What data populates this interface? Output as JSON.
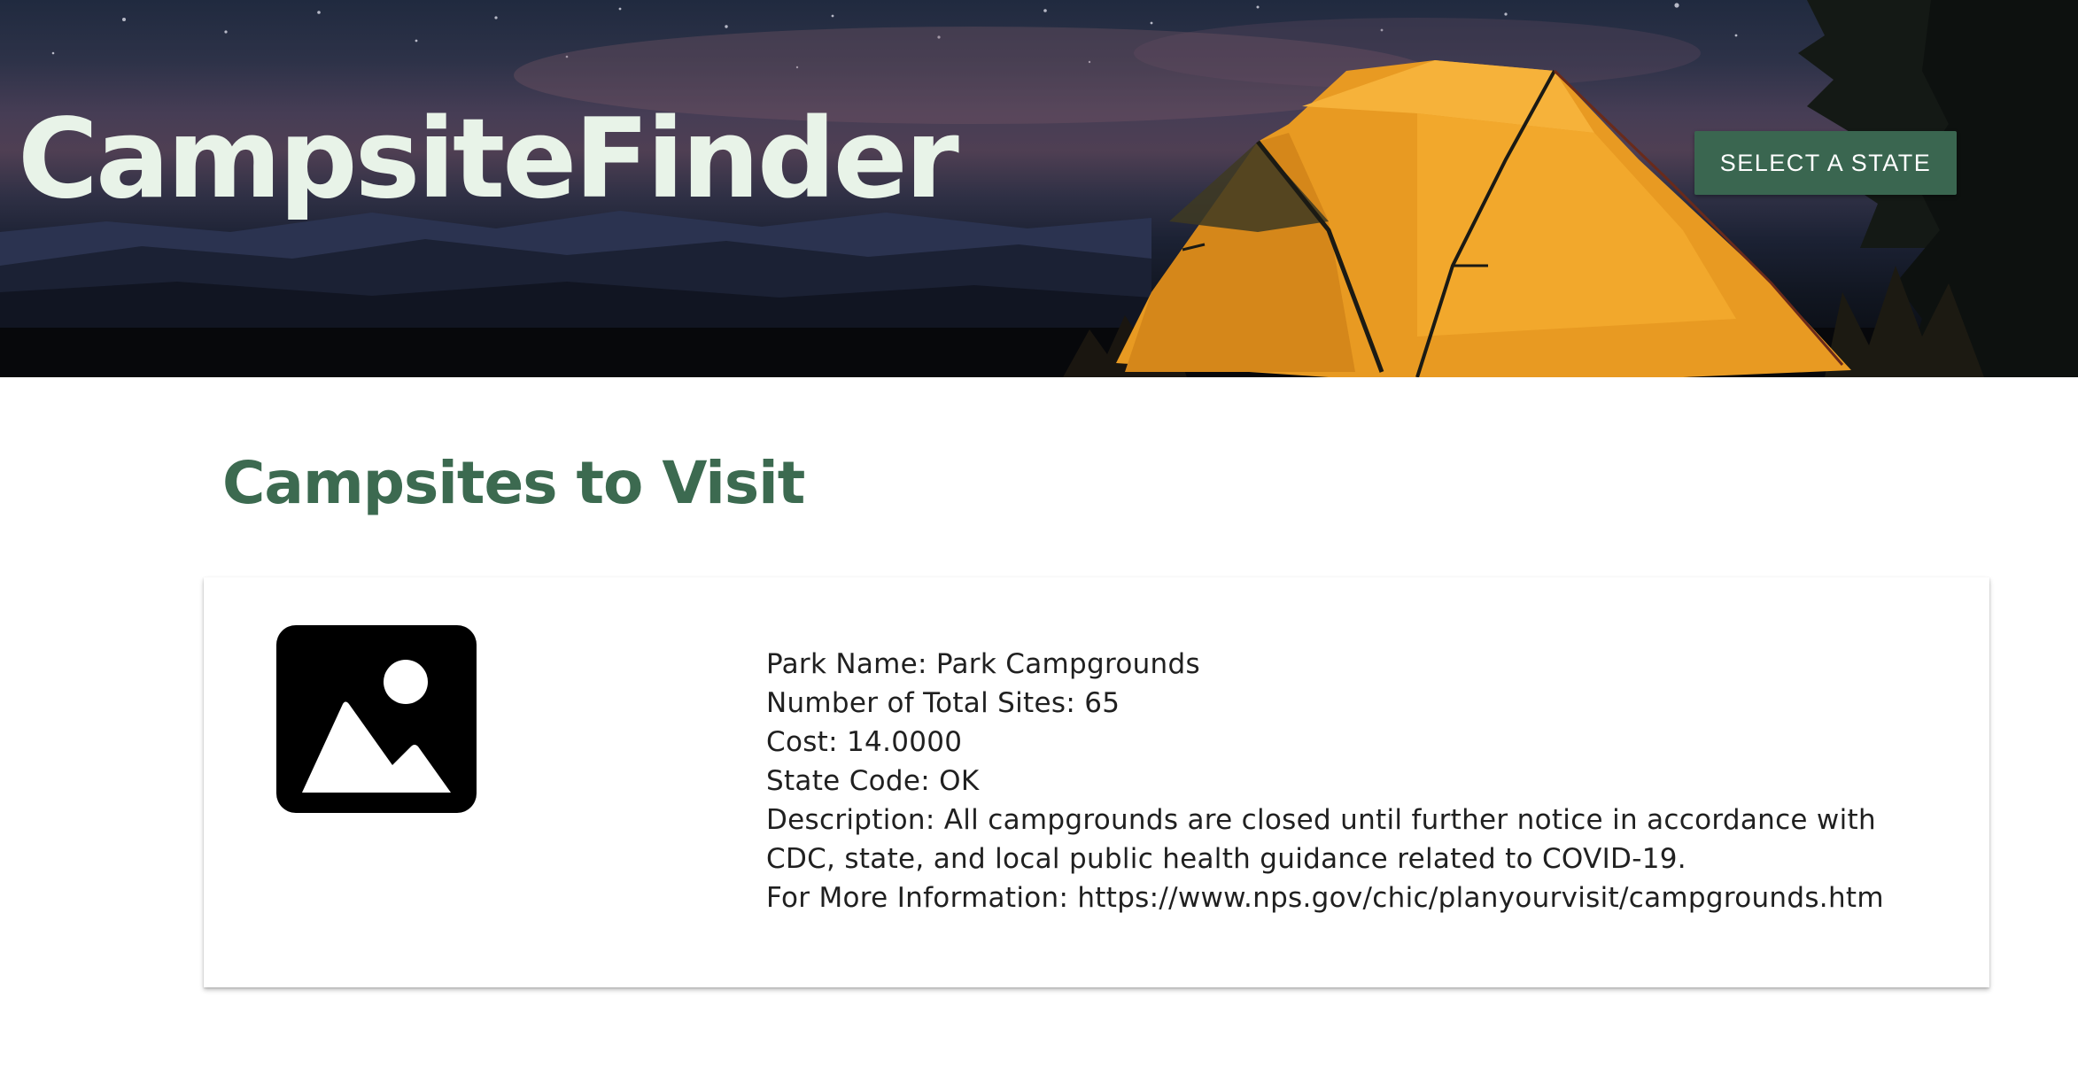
{
  "header": {
    "brand": "CampsiteFinder",
    "select_state_label": "SELECT A STATE"
  },
  "main": {
    "title": "Campsites to Visit",
    "campsites": [
      {
        "image_icon": "image-placeholder-icon",
        "park_name_label": "Park Name: ",
        "park_name": "Park Campgrounds",
        "total_sites_label": "Number of Total Sites: ",
        "total_sites": "65",
        "cost_label": "Cost: ",
        "cost": "14.0000",
        "state_code_label": "State Code: ",
        "state_code": "OK",
        "description_label": "Description: ",
        "description": "All campgrounds are closed until further notice in accordance with CDC, state, and local public health guidance related to COVID-19.",
        "more_info_label": "For More Information: ",
        "more_info_url": "https://www.nps.gov/chic/planyourvisit/campgrounds.htm"
      }
    ]
  },
  "colors": {
    "brand_text": "#e8f3e8",
    "accent_green": "#3a6650",
    "title_green": "#3c6a50",
    "tent_orange": "#f0a62c"
  }
}
